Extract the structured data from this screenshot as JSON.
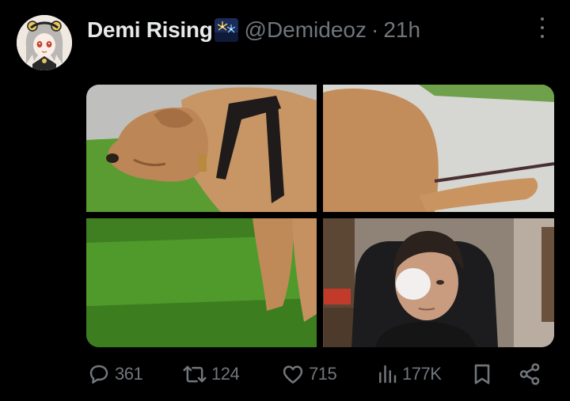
{
  "author": {
    "display_name": "Demi Rising",
    "handle": "@Demideoz",
    "separator": "·",
    "time": "21h",
    "badge_emoji": "fireworks-emoji"
  },
  "media": {
    "type": "photo-grid",
    "tiles": [
      {
        "name": "tile-top-left",
        "subject": "dog-head"
      },
      {
        "name": "tile-top-right",
        "subject": "dog-rear"
      },
      {
        "name": "tile-bottom-left",
        "subject": "grass-dog-leg"
      },
      {
        "name": "tile-bottom-right",
        "subject": "person-webcam"
      }
    ]
  },
  "actions": {
    "reply": {
      "icon": "reply-icon",
      "count": "361"
    },
    "repost": {
      "icon": "repost-icon",
      "count": "124"
    },
    "like": {
      "icon": "heart-icon",
      "count": "715"
    },
    "views": {
      "icon": "views-icon",
      "count": "177K"
    },
    "bookmark": {
      "icon": "bookmark-icon"
    },
    "share": {
      "icon": "share-icon"
    }
  },
  "colors": {
    "background": "#000000",
    "primary_text": "#e7e9ea",
    "secondary_text": "#71767b"
  }
}
